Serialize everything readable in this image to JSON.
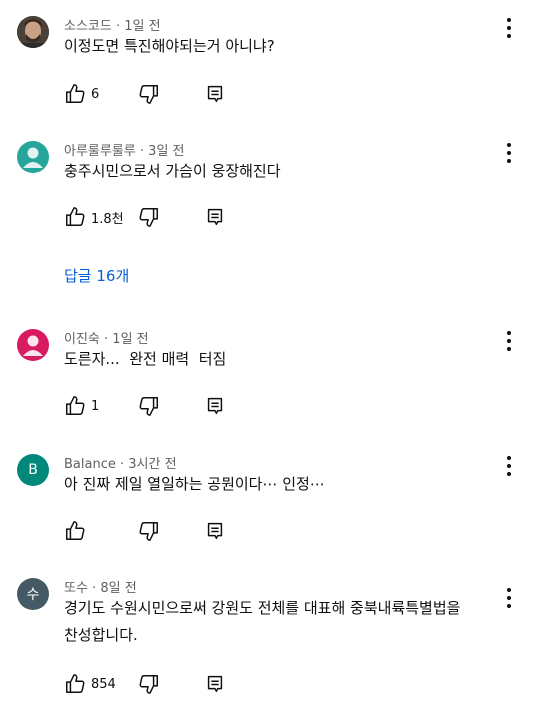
{
  "comments": [
    {
      "author": "소스코드",
      "time": "1일 전",
      "text": "이정도면 특진해야되는거 아니냐?",
      "likes": "6",
      "avatar": {
        "type": "photo",
        "color": "#6b5a4a"
      }
    },
    {
      "author": "아루룰루룰루",
      "time": "3일 전",
      "text": "충주시민으로서 가슴이 웅장해진다",
      "likes": "1.8천",
      "avatar": {
        "type": "default-person",
        "color": "#26a69a"
      }
    },
    {
      "author": "이진숙",
      "time": "1일 전",
      "text": "도른자...  완전 매력  터짐",
      "likes": "1",
      "avatar": {
        "type": "default-person",
        "color": "#d81b60"
      }
    },
    {
      "author": "Balance",
      "time": "3시간 전",
      "text": "아 진짜 제일 열일하는 공뭔이다⋯ 인정⋯",
      "likes": "",
      "avatar": {
        "type": "letter",
        "letter": "B",
        "color": "#00897b"
      }
    },
    {
      "author": "또수",
      "time": "8일 전",
      "text_line1": "경기도 수원시민으로써 강원도 전체를 대표해 중북내륙특별법을",
      "text_line2": "찬성합니다.",
      "likes": "854",
      "avatar": {
        "type": "letter",
        "letter": "수",
        "color": "#455a64"
      }
    }
  ],
  "replies_link": "답글 16개",
  "separator": " · "
}
